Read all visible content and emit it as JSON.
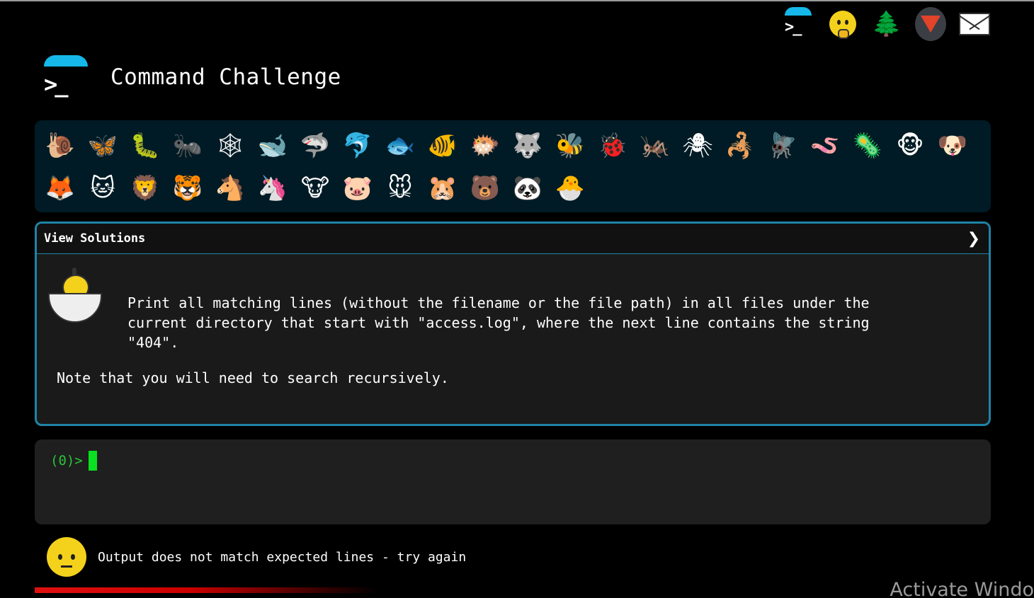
{
  "nav": {
    "items": [
      {
        "name": "terminal-icon"
      },
      {
        "name": "face-with-hand-icon"
      },
      {
        "name": "tree-icon"
      },
      {
        "name": "gitlab-icon"
      },
      {
        "name": "mail-icon"
      }
    ],
    "tree_glyph": "🌲"
  },
  "header": {
    "logo_glyph": ">_",
    "title": "Command Challenge"
  },
  "animals": [
    {
      "name": "snail",
      "glyph": "🐌"
    },
    {
      "name": "butterfly",
      "glyph": "🦋"
    },
    {
      "name": "caterpillar",
      "glyph": "🐛"
    },
    {
      "name": "ant",
      "glyph": "🐜"
    },
    {
      "name": "spider-web",
      "glyph": "🕸"
    },
    {
      "name": "whale",
      "glyph": "🐋"
    },
    {
      "name": "shark",
      "glyph": "🦈"
    },
    {
      "name": "dolphin",
      "glyph": "🐬"
    },
    {
      "name": "fish",
      "glyph": "🐟"
    },
    {
      "name": "tropical-fish",
      "glyph": "🐠"
    },
    {
      "name": "blowfish",
      "glyph": "🐡"
    },
    {
      "name": "wolf",
      "glyph": "🐺"
    },
    {
      "name": "bee",
      "glyph": "🐝"
    },
    {
      "name": "ladybug",
      "glyph": "🐞"
    },
    {
      "name": "cricket",
      "glyph": "🦗"
    },
    {
      "name": "spider",
      "glyph": "🕷"
    },
    {
      "name": "scorpion",
      "glyph": "🦂"
    },
    {
      "name": "fly",
      "glyph": "🪰"
    },
    {
      "name": "worm",
      "glyph": "🪱"
    },
    {
      "name": "microbe",
      "glyph": "🦠"
    },
    {
      "name": "monkey",
      "glyph": "🐵"
    },
    {
      "name": "dog",
      "glyph": "🐶"
    },
    {
      "name": "fox",
      "glyph": "🦊"
    },
    {
      "name": "cat",
      "glyph": "🐱"
    },
    {
      "name": "lion",
      "glyph": "🦁"
    },
    {
      "name": "tiger",
      "glyph": "🐯"
    },
    {
      "name": "horse",
      "glyph": "🐴"
    },
    {
      "name": "unicorn",
      "glyph": "🦄"
    },
    {
      "name": "cow",
      "glyph": "🐮"
    },
    {
      "name": "pig",
      "glyph": "🐷"
    },
    {
      "name": "mouse",
      "glyph": "🐭"
    },
    {
      "name": "hamster",
      "glyph": "🐹"
    },
    {
      "name": "bear",
      "glyph": "🐻"
    },
    {
      "name": "panda",
      "glyph": "🐼"
    },
    {
      "name": "hatching-chick",
      "glyph": "🐣"
    }
  ],
  "solutions": {
    "title": "View Solutions",
    "chevron": "❯",
    "description": "Print all matching lines (without the filename or the file path) in all files under the\ncurrent directory that start with \"access.log\", where the next line contains the string\n\"404\".",
    "note": "Note that you will need to search recursively."
  },
  "terminal": {
    "prompt": "(0)>"
  },
  "result": {
    "message": "Output does not match expected lines - try again",
    "progress": 0.6
  },
  "watermark": "Activate Windo"
}
